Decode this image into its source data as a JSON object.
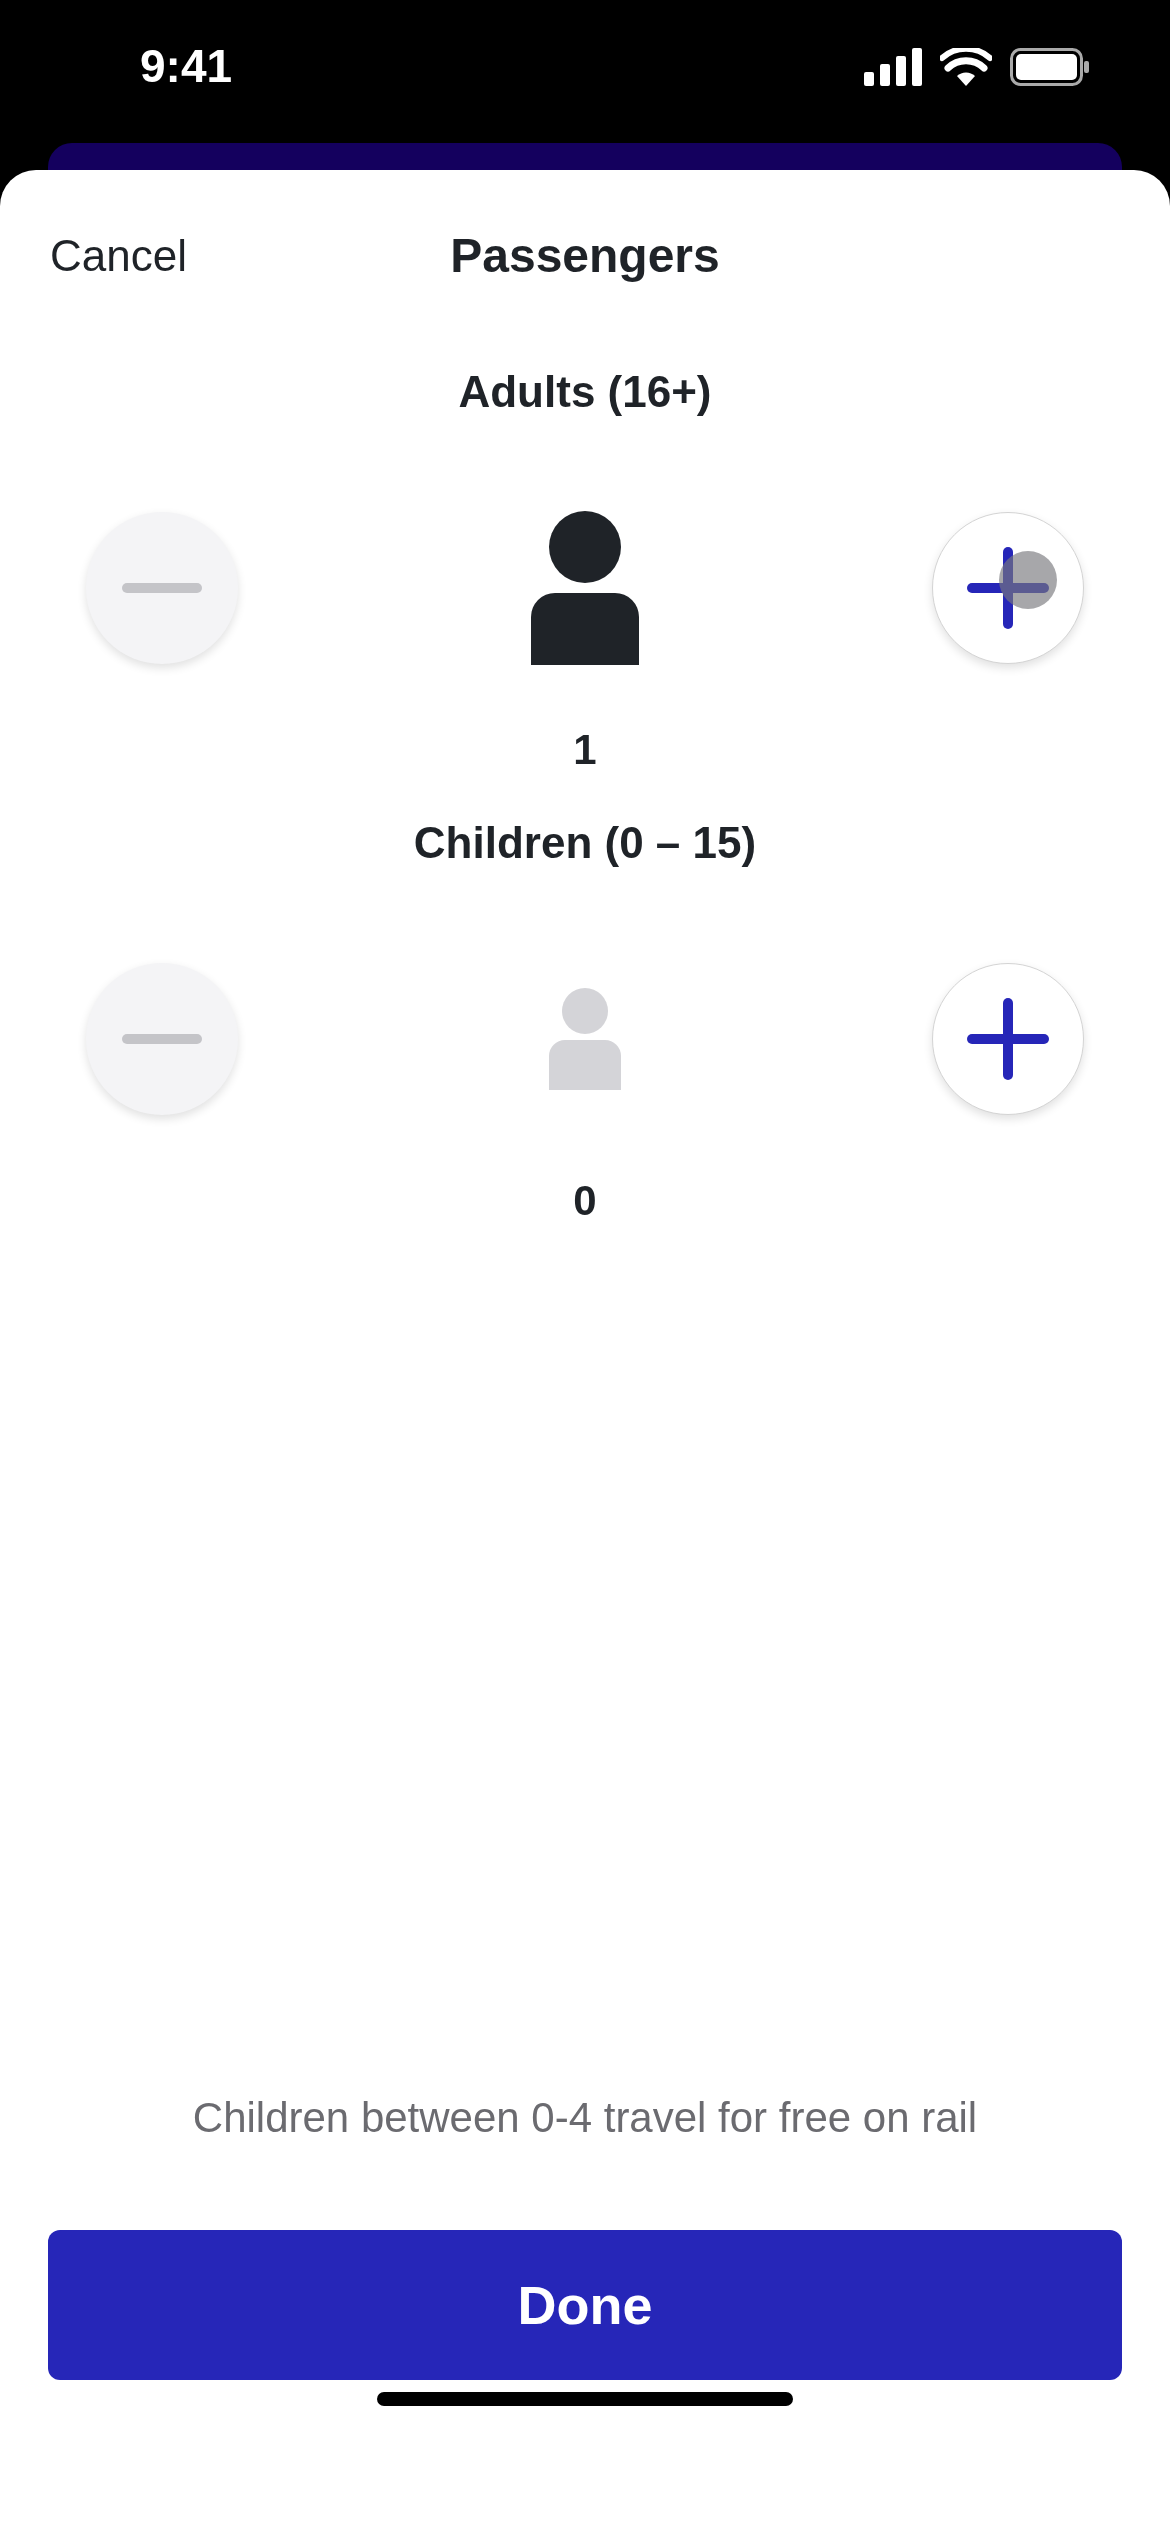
{
  "status_bar": {
    "time": "9:41"
  },
  "header": {
    "cancel": "Cancel",
    "title": "Passengers"
  },
  "groups": [
    {
      "kind": "adult",
      "label": "Adults (16+)",
      "count": "1",
      "minus_disabled": true,
      "plus_pressed": true
    },
    {
      "kind": "child",
      "label": "Children (0 – 15)",
      "count": "0",
      "minus_disabled": true,
      "plus_pressed": false
    }
  ],
  "note": "Children between 0-4 travel for free on rail",
  "done_button": "Done"
}
